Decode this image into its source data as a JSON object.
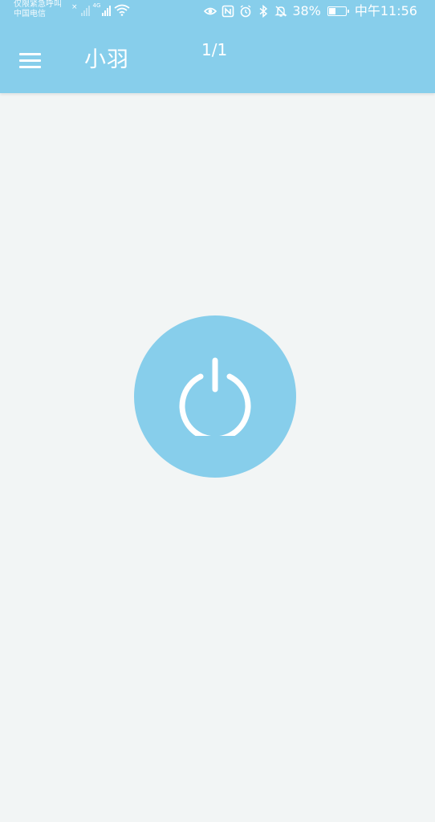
{
  "status_bar": {
    "emergency_text": "仅限紧急呼叫",
    "carrier": "中国电信",
    "network_type": "4G",
    "battery_percent": "38%",
    "time": "中午11:56",
    "icons": [
      "eye-icon",
      "nfc-icon",
      "alarm-icon",
      "bluetooth-icon",
      "mute-icon",
      "battery-icon",
      "wifi-icon",
      "signal-icon"
    ]
  },
  "toolbar": {
    "menu_icon": "hamburger-menu-icon",
    "title": "小羽",
    "page_counter": "1/1"
  },
  "main": {
    "power_icon": "power-icon"
  },
  "colors": {
    "accent": "#87ceeb",
    "background": "#f2f5f5",
    "icon": "#ffffff"
  }
}
